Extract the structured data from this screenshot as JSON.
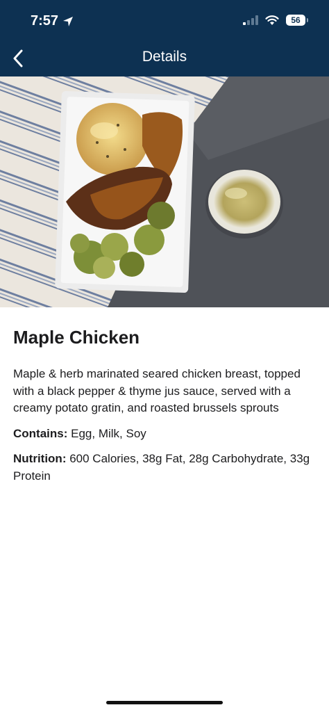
{
  "status_bar": {
    "time": "7:57",
    "battery": "56"
  },
  "nav": {
    "title": "Details",
    "back_icon": "chevron-left-icon"
  },
  "colors": {
    "nav_background": "#0d3152",
    "text": "#1c1c1e",
    "background": "#ffffff"
  },
  "meal": {
    "name": "Maple Chicken",
    "description": "Maple & herb marinated seared chicken breast, topped with a black pepper & thyme jus sauce, served with a creamy potato gratin, and roasted brussels sprouts",
    "contains_label": "Contains:",
    "contains_value": "Egg, Milk, Soy",
    "nutrition_label": "Nutrition:",
    "nutrition_value": "600 Calories, 38g Fat, 28g Carbohydrate, 33g Protein"
  }
}
